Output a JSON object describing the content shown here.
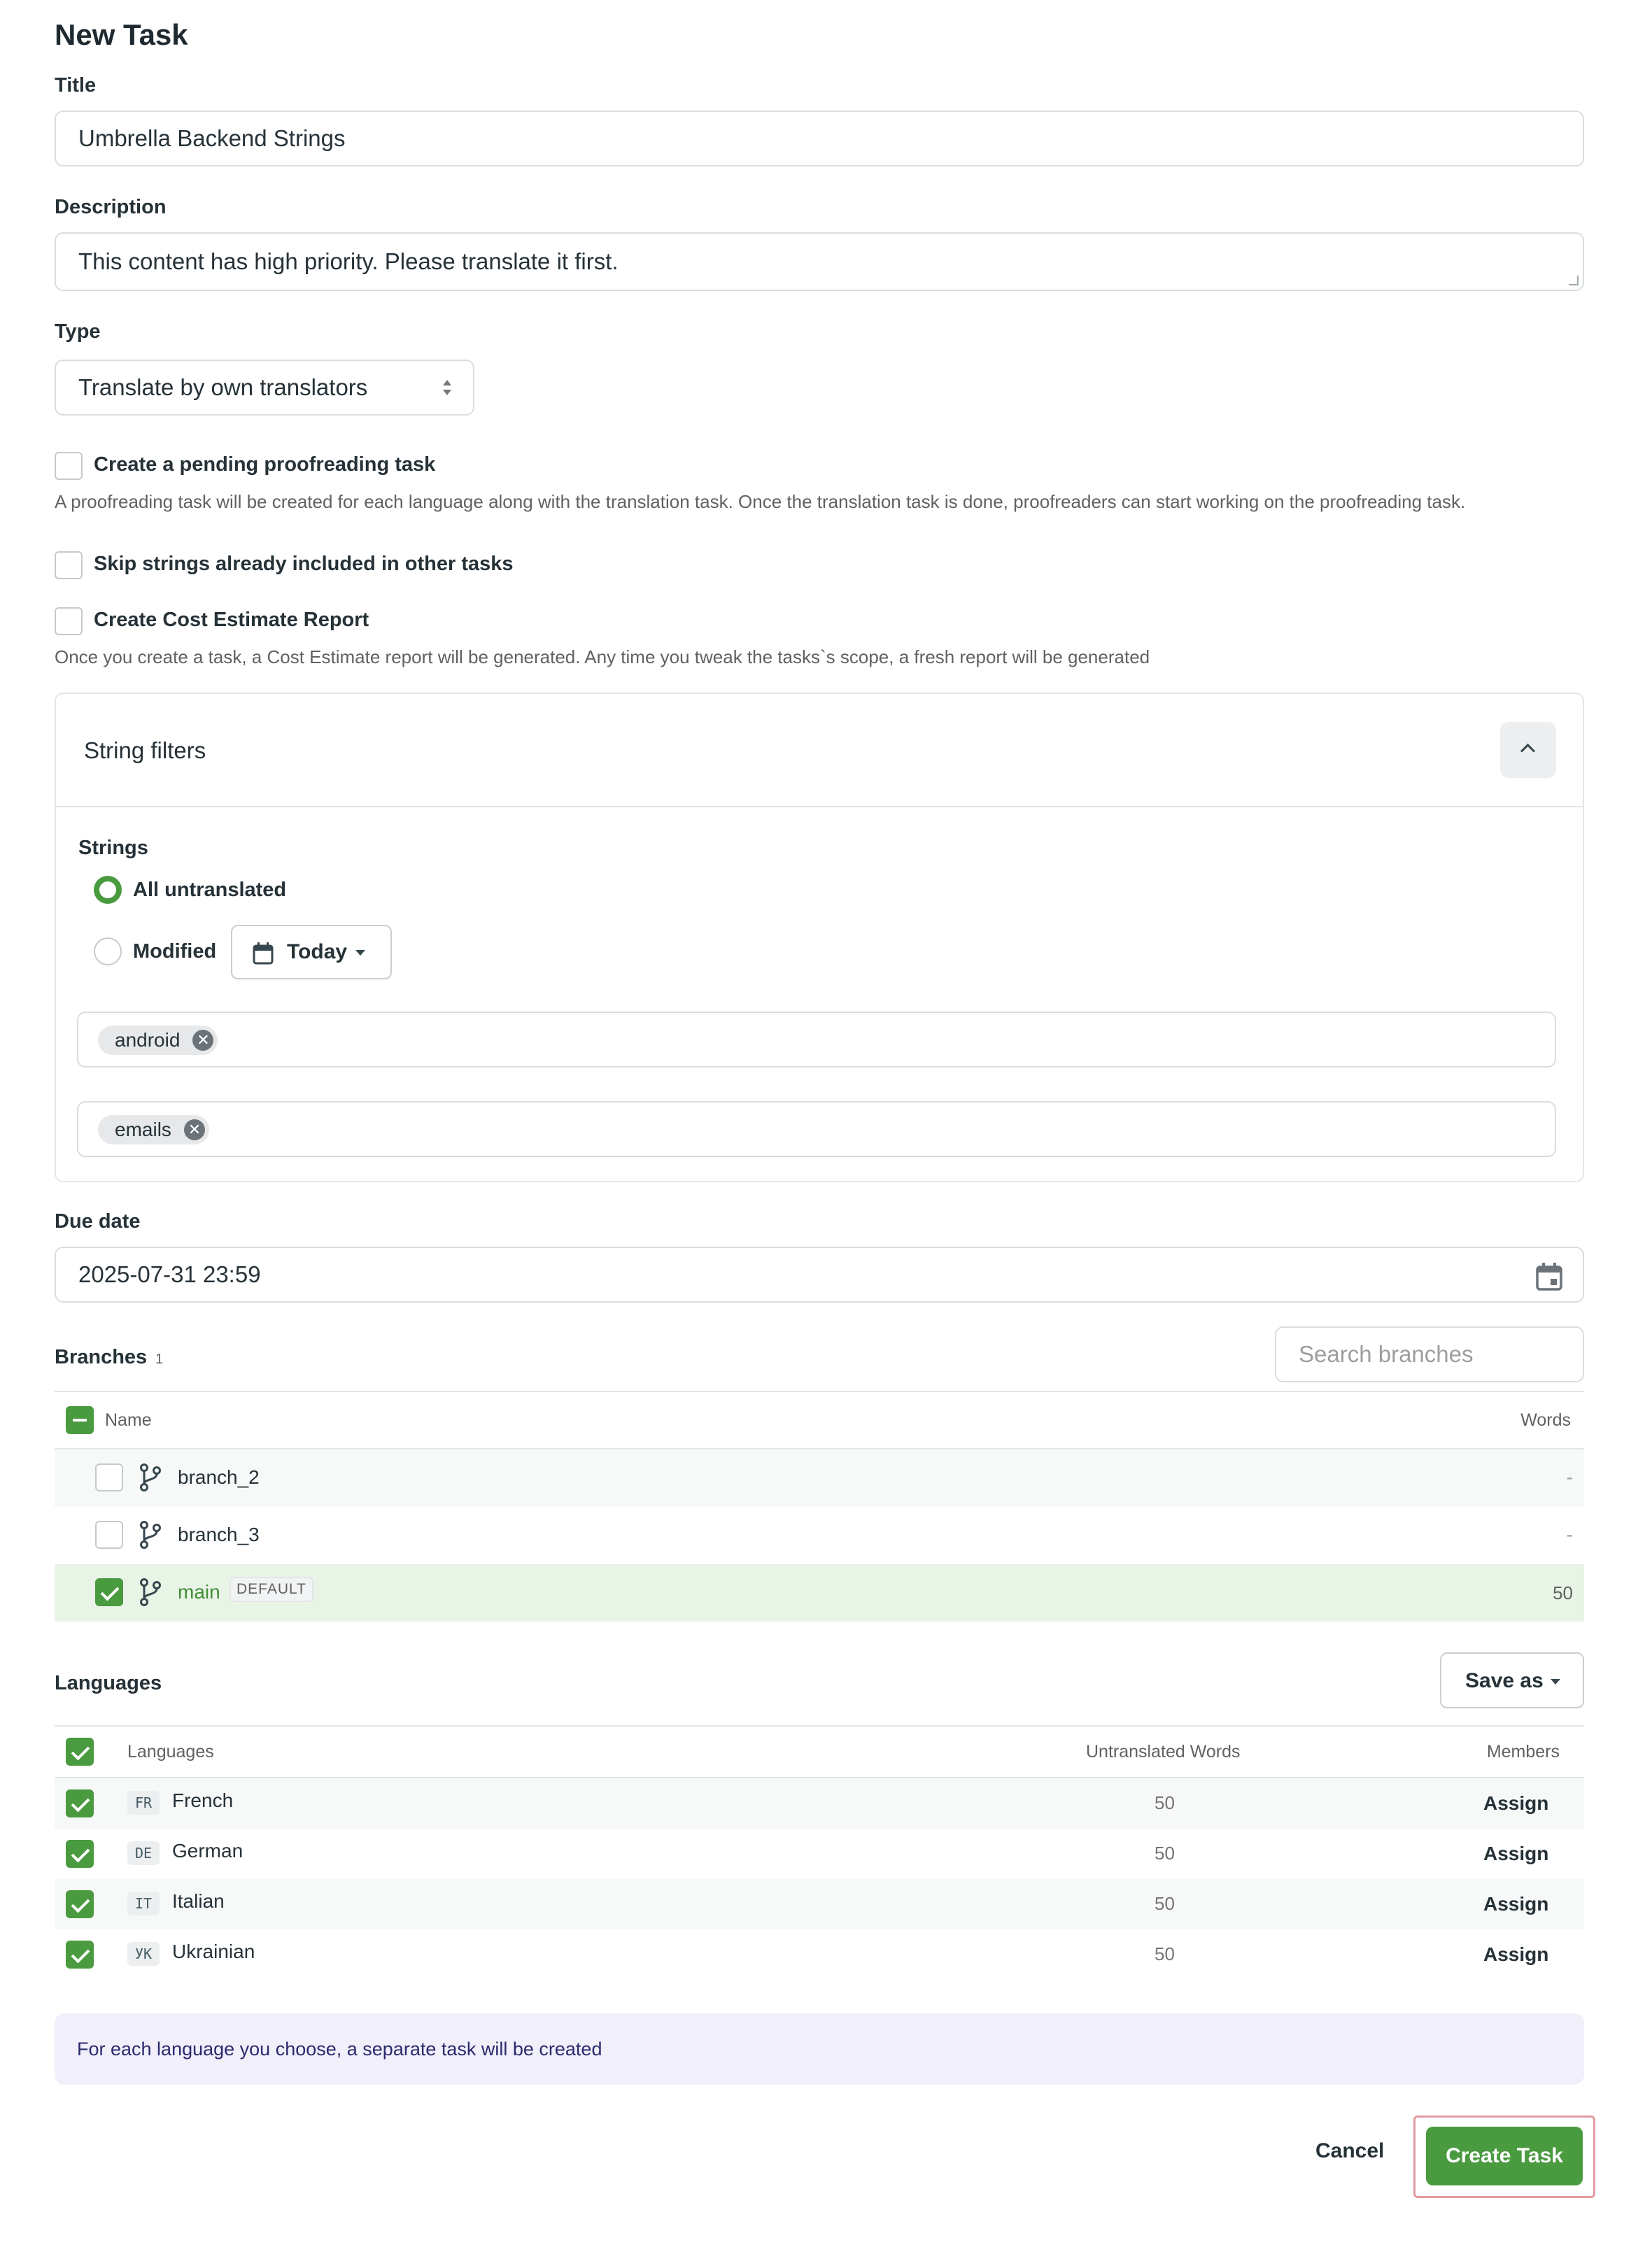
{
  "page_title": "New Task",
  "title_field": {
    "label": "Title",
    "value": "Umbrella Backend Strings"
  },
  "description_field": {
    "label": "Description",
    "value": "This content has high priority. Please translate it first."
  },
  "type_field": {
    "label": "Type",
    "value": "Translate by own translators"
  },
  "options": {
    "proofreading": {
      "label": "Create a pending proofreading task",
      "checked": false,
      "help": "A proofreading task will be created for each language along with the translation task. Once the translation task is done, proofreaders can start working on the proofreading task."
    },
    "skip_strings": {
      "label": "Skip strings already included in other tasks",
      "checked": false
    },
    "cost_estimate": {
      "label": "Create Cost Estimate Report",
      "checked": false,
      "help": "Once you create a task, a Cost Estimate report will be generated. Any time you tweak the tasks`s scope, a fresh report will be generated"
    }
  },
  "string_filters": {
    "title": "String filters",
    "strings_label": "Strings",
    "radio_all": "All untranslated",
    "radio_modified": "Modified",
    "modified_period": "Today",
    "chips_1": [
      "android"
    ],
    "chips_2": [
      "emails"
    ]
  },
  "due_date": {
    "label": "Due date",
    "value": "2025-07-31 23:59"
  },
  "branches": {
    "label": "Branches",
    "count": "1",
    "search_placeholder": "Search branches",
    "col_name": "Name",
    "col_words": "Words",
    "rows": [
      {
        "name": "branch_2",
        "words": "-",
        "checked": false,
        "tag": ""
      },
      {
        "name": "branch_3",
        "words": "-",
        "checked": false,
        "tag": ""
      },
      {
        "name": "main",
        "words": "50",
        "checked": true,
        "tag": "DEFAULT"
      }
    ]
  },
  "languages": {
    "label": "Languages",
    "save_as": "Save as",
    "col_languages": "Languages",
    "col_untranslated": "Untranslated Words",
    "col_members": "Members",
    "rows": [
      {
        "code": "FR",
        "name": "French",
        "words": "50",
        "action": "Assign"
      },
      {
        "code": "DE",
        "name": "German",
        "words": "50",
        "action": "Assign"
      },
      {
        "code": "IT",
        "name": "Italian",
        "words": "50",
        "action": "Assign"
      },
      {
        "code": "УК",
        "name": "Ukrainian",
        "words": "50",
        "action": "Assign"
      }
    ]
  },
  "info_note": "For each language you choose, a separate task will be created",
  "footer": {
    "cancel": "Cancel",
    "create": "Create Task"
  },
  "colors": {
    "accent": "#4a9a3f",
    "selected_row": "#e8f4e6",
    "info_bg": "#f1effa"
  }
}
